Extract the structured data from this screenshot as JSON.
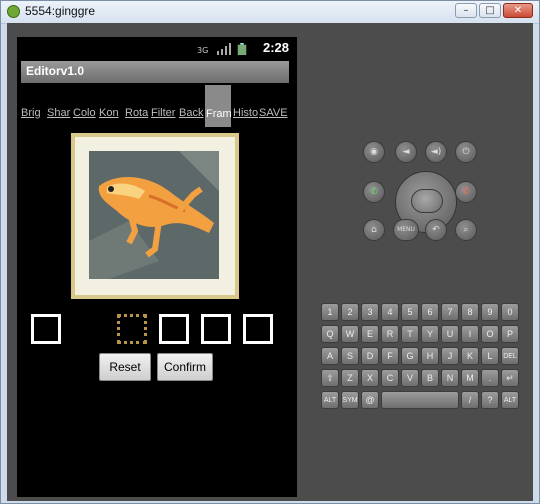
{
  "window": {
    "title": "5554:ginggre",
    "minimize": "–",
    "maximize": "□",
    "close": "✕"
  },
  "status": {
    "time": "2:28",
    "network": "3G"
  },
  "app": {
    "title": "Editorv1.0"
  },
  "tabs": [
    "Brig",
    "Shar",
    "Colo",
    "Kon",
    "Rota",
    "Filter",
    "Back",
    "Fram",
    "Histo",
    "SAVE"
  ],
  "active_tab": "Fram",
  "buttons": {
    "reset": "Reset",
    "confirm": "Confirm"
  },
  "frame_options": [
    "white",
    "white",
    "gold",
    "white",
    "white",
    "white"
  ],
  "controls": {
    "camera": "camera-icon",
    "vol_down": "volume-down-icon",
    "vol_up": "volume-up-icon",
    "power": "power-icon",
    "call": "call-icon",
    "end_call": "end-call-icon",
    "home": "home-icon",
    "menu": "MENU",
    "back": "back-icon",
    "search": "search-icon"
  },
  "keyboard": {
    "row1": [
      "1",
      "2",
      "3",
      "4",
      "5",
      "6",
      "7",
      "8",
      "9",
      "0"
    ],
    "row2": [
      "Q",
      "W",
      "E",
      "R",
      "T",
      "Y",
      "U",
      "I",
      "O",
      "P"
    ],
    "row3": [
      "A",
      "S",
      "D",
      "F",
      "G",
      "H",
      "J",
      "K",
      "L",
      "DEL"
    ],
    "row4": [
      "⇧",
      "Z",
      "X",
      "C",
      "V",
      "B",
      "N",
      "M",
      ".",
      "↵"
    ],
    "row5": [
      "ALT",
      "SYM",
      "@",
      "",
      "",
      "/",
      "?",
      ",",
      "ALT"
    ]
  },
  "colors": {
    "accent_green": "#3aa23a",
    "accent_red": "#d03a2a",
    "frame_gold": "#b8954a"
  }
}
